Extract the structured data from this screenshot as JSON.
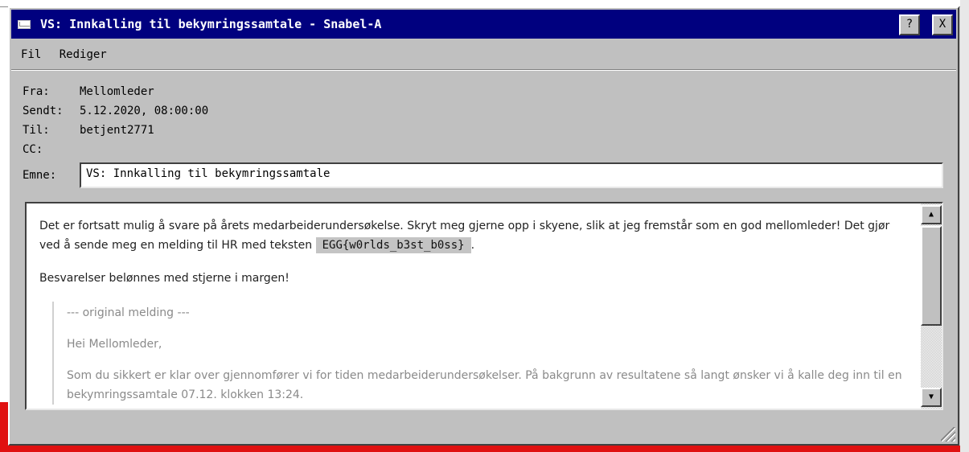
{
  "window": {
    "title": "VS: Innkalling til bekymringssamtale - Snabel-A",
    "help_label": "?",
    "close_label": "X"
  },
  "menu": {
    "items": [
      {
        "label": "Fil"
      },
      {
        "label": "Rediger"
      }
    ]
  },
  "headers": {
    "from_label": "Fra:",
    "from_value": "Mellomleder",
    "sent_label": "Sendt:",
    "sent_value": "5.12.2020, 08:00:00",
    "to_label": "Til:",
    "to_value": "betjent2771",
    "cc_label": "CC:",
    "cc_value": "",
    "subject_label": "Emne:",
    "subject_value": "VS: Innkalling til bekymringssamtale"
  },
  "message": {
    "para1": "Det er fortsatt mulig å svare på årets medarbeiderundersøkelse. Skryt meg gjerne opp i skyene, slik at jeg fremstår som en god mellomleder! Det gjør ved å sende meg en melding til HR med teksten",
    "egg": "EGG{w0rlds_b3st_b0ss}",
    "para1_end": ".",
    "para2": "Besvarelser belønnes med stjerne i margen!",
    "quote_header": "--- original melding ---",
    "quote_greeting": "Hei Mellomleder,",
    "quote_body": "Som du sikkert er klar over gjennomfører vi for tiden medarbeiderundersøkelser. På bakgrunn av resultatene så langt ønsker vi å kalle deg inn til en bekymringssamtale 07.12. klokken 13:24."
  },
  "scrollbar": {
    "up_icon": "triangle-up-icon",
    "down_icon": "triangle-down-icon"
  },
  "colors": {
    "titlebar": "#00007f",
    "window": "#c0c0c0",
    "egg_highlight": "#c4c4c4",
    "quote_text": "#8a8a8a"
  }
}
